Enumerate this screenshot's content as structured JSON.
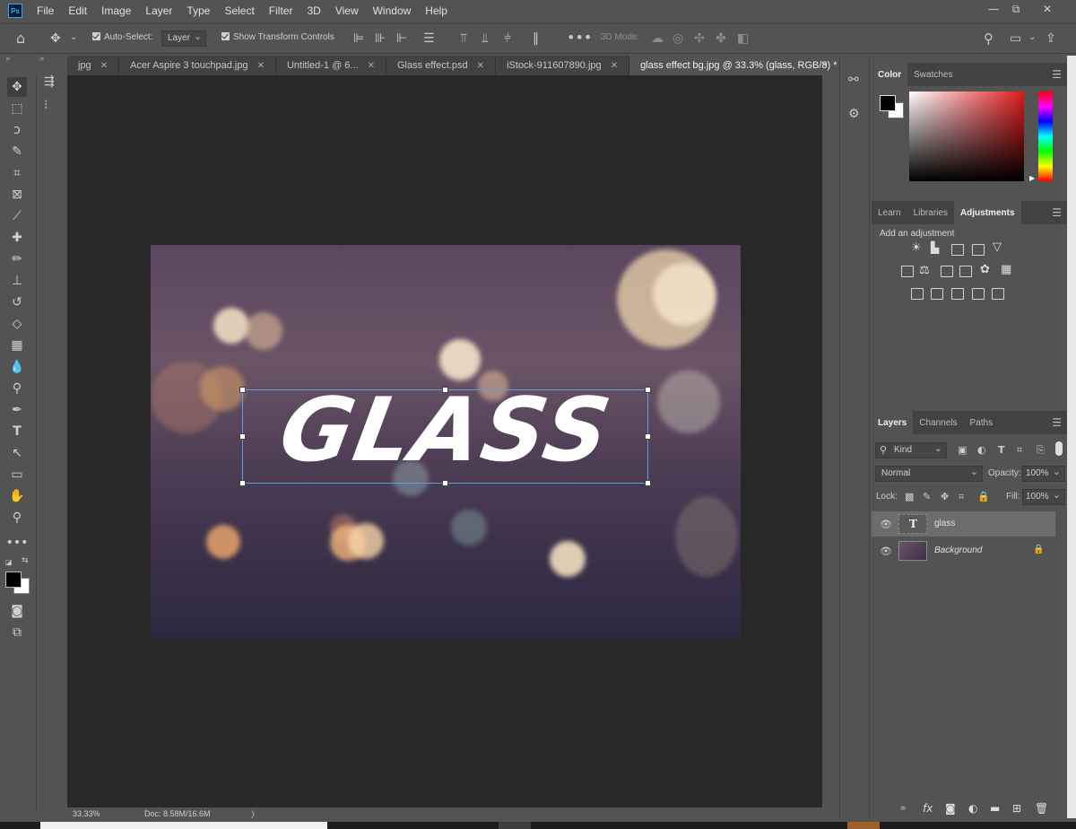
{
  "app": {
    "logo": "Ps"
  },
  "menu": [
    "File",
    "Edit",
    "Image",
    "Layer",
    "Type",
    "Select",
    "Filter",
    "3D",
    "View",
    "Window",
    "Help"
  ],
  "window_controls": {
    "minimize": "—",
    "restore": "⧉",
    "close": "✕"
  },
  "options": {
    "auto_select_label": "Auto-Select:",
    "layer_dropdown": "Layer",
    "show_transform_label": "Show Transform Controls",
    "mode_3d_label": "3D Mode:"
  },
  "tabs": [
    {
      "label": "jpg",
      "close": "✕"
    },
    {
      "label": "Acer Aspire 3 touchpad.jpg",
      "close": "✕"
    },
    {
      "label": "Untitled-1 @ 6...",
      "close": "✕"
    },
    {
      "label": "Glass effect.psd",
      "close": "✕"
    },
    {
      "label": "iStock-911607890.jpg",
      "close": "✕"
    },
    {
      "label": "glass effect bg.jpg @ 33.3% (glass, RGB/8) *",
      "close": "✕"
    }
  ],
  "tab_overflow": "»",
  "canvas": {
    "text": "GLASS"
  },
  "status": {
    "zoom": "33.33%",
    "doc": "Doc: 8.58M/16.6M",
    "arrow": "〉"
  },
  "color_panel": {
    "tabs": [
      "Color",
      "Swatches"
    ],
    "colors": {
      "foreground": "#000000",
      "background": "#ffffff"
    }
  },
  "adjust_panel": {
    "tabs": [
      "Learn",
      "Libraries",
      "Adjustments"
    ],
    "heading": "Add an adjustment"
  },
  "layers_panel": {
    "tabs": [
      "Layers",
      "Channels",
      "Paths"
    ],
    "filter_kind": "Kind",
    "blend_mode": "Normal",
    "opacity_label": "Opacity:",
    "opacity_value": "100%",
    "lock_label": "Lock:",
    "fill_label": "Fill:",
    "fill_value": "100%",
    "layers": [
      {
        "name": "glass",
        "type_glyph": "T"
      },
      {
        "name": "Background"
      }
    ],
    "footer_icons": [
      "link-icon",
      "fx-icon",
      "mask-icon",
      "adjustment-icon",
      "group-icon",
      "new-layer-icon",
      "trash-icon"
    ],
    "fx_label": "fx"
  }
}
